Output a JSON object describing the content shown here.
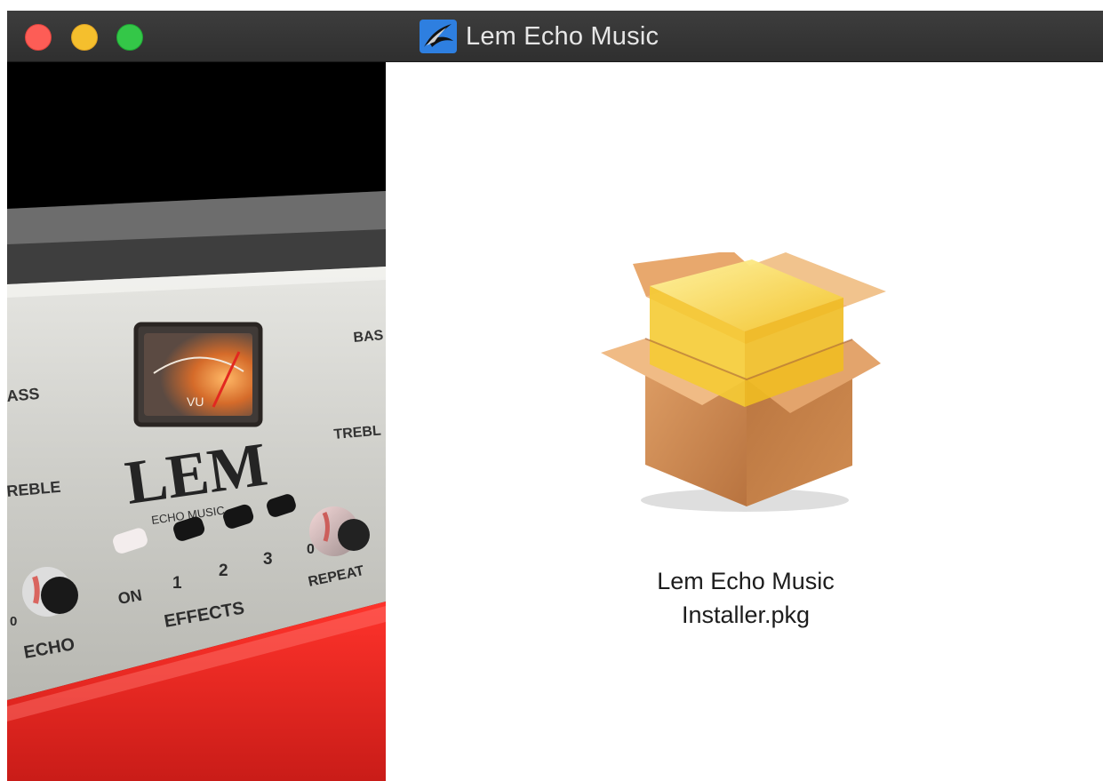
{
  "window": {
    "title": "Lem Echo Music",
    "controls": [
      "close",
      "minimize",
      "zoom"
    ],
    "app_icon": "bird-icon"
  },
  "hero": {
    "brand": "LEM",
    "subtitle": "ECHO MUSIC",
    "meter": "VU",
    "labels": {
      "bass_left": "ASS",
      "treble_left": "REBLE",
      "bass_right": "BAS",
      "treble_right": "TREBL",
      "echo": "ECHO",
      "zero_echo": "0",
      "on": "ON",
      "effect_1": "1",
      "effect_2": "2",
      "effect_3": "3",
      "effects": "EFFECTS",
      "zero_repeat": "0",
      "repeat": "REPEAT"
    }
  },
  "content": {
    "file": {
      "name_line1": "Lem Echo Music",
      "name_line2": "Installer.pkg",
      "icon": "package-icon"
    }
  },
  "colors": {
    "titlebar": "#333333",
    "close": "#fd5d56",
    "minimize": "#f5bf2d",
    "zoom": "#34c748",
    "title_text": "#e6e6e6",
    "package_box": "#c5844b",
    "package_fill": "#f7cd3a"
  }
}
